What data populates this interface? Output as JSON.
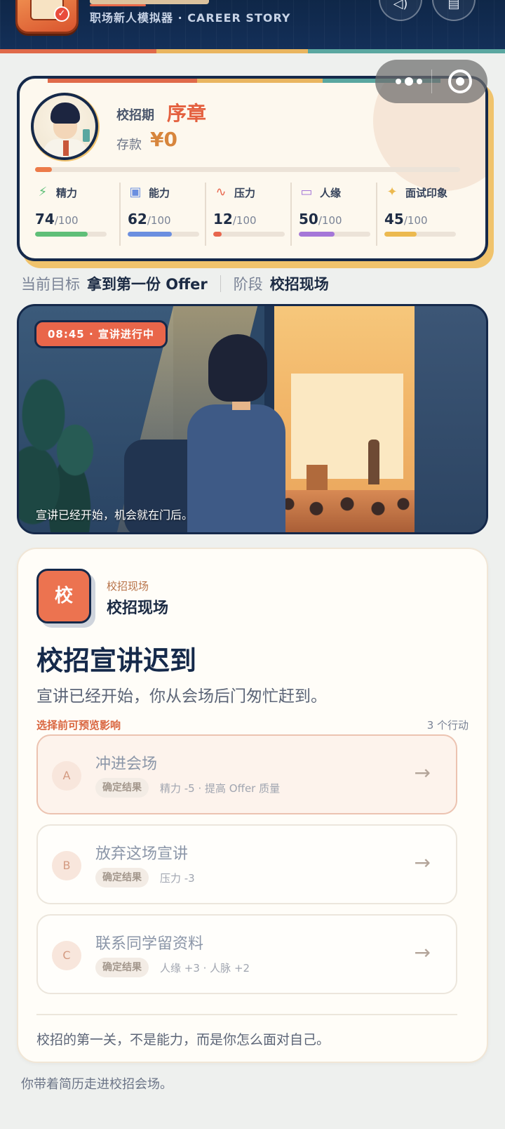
{
  "header": {
    "subtitle": "职场新人模拟器 · CAREER STORY",
    "sound_icon": "speaker-icon",
    "menu_icon": "document-icon"
  },
  "capsule": {
    "more_icon": "more-dots-icon",
    "close_icon": "target-icon"
  },
  "status": {
    "phase_label": "校招期",
    "phase_value": "序章",
    "savings_label": "存款",
    "savings_value": "¥0",
    "progress": 0.04,
    "stats": [
      {
        "name": "精力",
        "value": "74",
        "max": "/100",
        "icon": "⚡",
        "color": "#5fbf78",
        "level": 0.74
      },
      {
        "name": "能力",
        "value": "62",
        "max": "/100",
        "icon": "▣",
        "color": "#6b8fe0",
        "level": 0.62
      },
      {
        "name": "压力",
        "value": "12",
        "max": "/100",
        "icon": "∿",
        "color": "#e8664d",
        "level": 0.12
      },
      {
        "name": "人缘",
        "value": "50",
        "max": "/100",
        "icon": "▭",
        "color": "#a577d8",
        "level": 0.5
      },
      {
        "name": "面试印象",
        "value": "45",
        "max": "/100",
        "icon": "✦",
        "color": "#ecb94f",
        "level": 0.45
      }
    ]
  },
  "goal": {
    "label": "当前目标",
    "value": "拿到第一份 Offer",
    "stage_label": "阶段",
    "stage_value": "校招现场"
  },
  "scene": {
    "tag": "08:45 · 宣讲进行中",
    "caption": "宣讲已经开始，机会就在门后。"
  },
  "event": {
    "icon_char": "校",
    "location_small": "校招现场",
    "location_big": "校招现场",
    "title": "校招宣讲迟到",
    "description": "宣讲已经开始，你从会场后门匆忙赶到。",
    "hint": "选择前可预览影响",
    "count": "3 个行动",
    "options": [
      {
        "letter": "A",
        "title": "冲进会场",
        "tag": "确定结果",
        "effect": "精力 -5 · 提高 Offer 质量"
      },
      {
        "letter": "B",
        "title": "放弃这场宣讲",
        "tag": "确定结果",
        "effect": "压力 -3"
      },
      {
        "letter": "C",
        "title": "联系同学留资料",
        "tag": "确定结果",
        "effect": "人缘 +3 · 人脉 +2"
      }
    ],
    "footer": "校招的第一关，不是能力，而是你怎么面对自己。"
  },
  "bottom_note": "你带着简历走进校招会场。"
}
